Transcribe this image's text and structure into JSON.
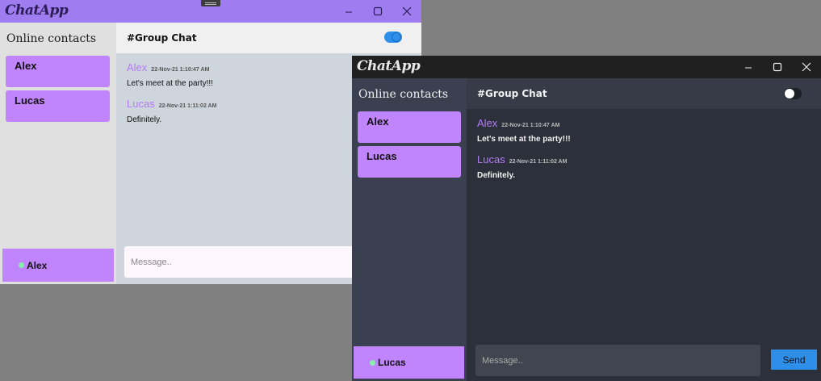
{
  "colors": {
    "accent": "#9f7cf0",
    "contact_bg": "#c084fc",
    "author": "#b07cf4",
    "send": "#2d8fe8",
    "online_dot": "#86efac"
  },
  "light_window": {
    "app_name": "ChatApp",
    "sidebar_title": "Online contacts",
    "contacts": [
      "Alex",
      "Lucas"
    ],
    "current_user": "Alex",
    "chat_title": "#Group Chat",
    "theme_toggle_on": true,
    "messages": [
      {
        "author": "Alex",
        "time": "22-Nov-21 1:10:47 AM",
        "text": "Let's meet at the party!!!"
      },
      {
        "author": "Lucas",
        "time": "22-Nov-21 1:11:02 AM",
        "text": "Definitely."
      }
    ],
    "input_placeholder": "Message.."
  },
  "dark_window": {
    "app_name": "ChatApp",
    "sidebar_title": "Online contacts",
    "contacts": [
      "Alex",
      "Lucas"
    ],
    "current_user": "Lucas",
    "chat_title": "#Group Chat",
    "theme_toggle_on": false,
    "messages": [
      {
        "author": "Alex",
        "time": "22-Nov-21 1:10:47 AM",
        "text": "Let's meet at the party!!!"
      },
      {
        "author": "Lucas",
        "time": "22-Nov-21 1:11:02 AM",
        "text": "Definitely."
      }
    ],
    "input_placeholder": "Message..",
    "send_label": "Send"
  }
}
